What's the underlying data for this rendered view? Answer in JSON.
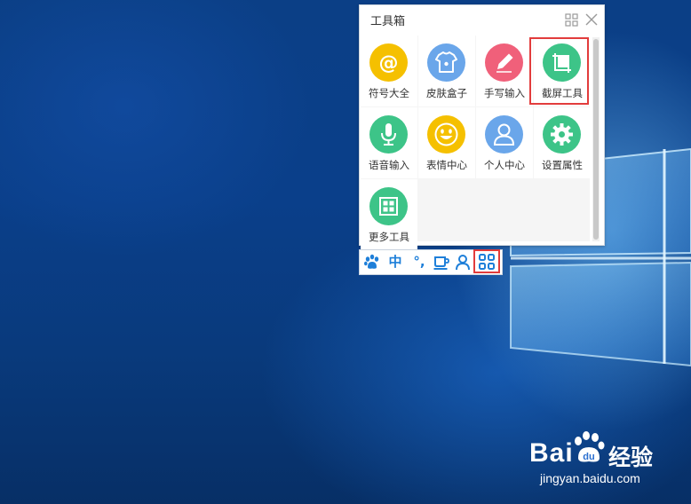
{
  "toolbox": {
    "title": "工具箱",
    "tiles": [
      {
        "label": "符号大全",
        "icon": "at-sign-icon",
        "color": "#f5c000"
      },
      {
        "label": "皮肤盒子",
        "icon": "tshirt-icon",
        "color": "#6aa6ea"
      },
      {
        "label": "手写输入",
        "icon": "pen-icon",
        "color": "#f0607a"
      },
      {
        "label": "截屏工具",
        "icon": "crop-icon",
        "color": "#3dc488"
      },
      {
        "label": "语音输入",
        "icon": "microphone-icon",
        "color": "#3dc488"
      },
      {
        "label": "表情中心",
        "icon": "smiley-icon",
        "color": "#f5c000"
      },
      {
        "label": "个人中心",
        "icon": "user-icon",
        "color": "#6aa6ea"
      },
      {
        "label": "设置属性",
        "icon": "gear-icon",
        "color": "#3dc488"
      },
      {
        "label": "更多工具",
        "icon": "grid-icon",
        "color": "#3dc488"
      }
    ]
  },
  "ime_bar": {
    "chinese_mode": "中",
    "punctuation": "°,",
    "accent_color": "#1e7fd9"
  },
  "watermark": {
    "brand": "Bai",
    "brand_suffix": "经验",
    "url": "jingyan.baidu.com"
  },
  "highlight_color": "#e23c3c"
}
